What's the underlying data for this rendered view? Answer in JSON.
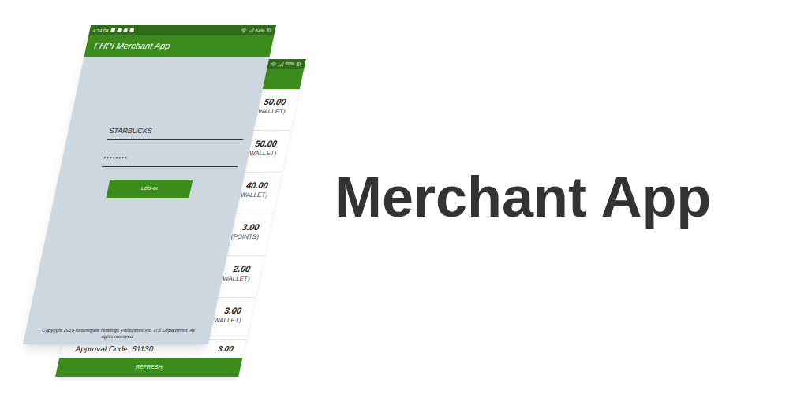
{
  "front_screen": {
    "status_bar": {
      "time": "4:34:04",
      "battery": "64%"
    },
    "title": "FHPI Merchant App",
    "username": "STARBUCKS",
    "password": "••••••••",
    "login_button": "LOG-IN",
    "copyright": "Copyright 2019 fortunegate Holdings Philippines Inc. ITS Department. All rights reserved"
  },
  "back_screen": {
    "status_bar": {
      "battery": "60%"
    },
    "transactions": [
      {
        "amount": "50.00",
        "type": "(WALLET)"
      },
      {
        "amount": "50.00",
        "type": "(WALLET)"
      },
      {
        "amount": "40.00",
        "type": "(WALLET)"
      },
      {
        "amount": "3.00",
        "type": "(POINTS)"
      },
      {
        "amount": "2.00",
        "type": "(WALLET)"
      },
      {
        "amount": "3.00",
        "type": "(WALLET)"
      }
    ],
    "approval": {
      "label": "Approval Code: 61130",
      "amount": "3.00"
    },
    "refresh_button": "REFRESH"
  },
  "headline": "Merchant App"
}
